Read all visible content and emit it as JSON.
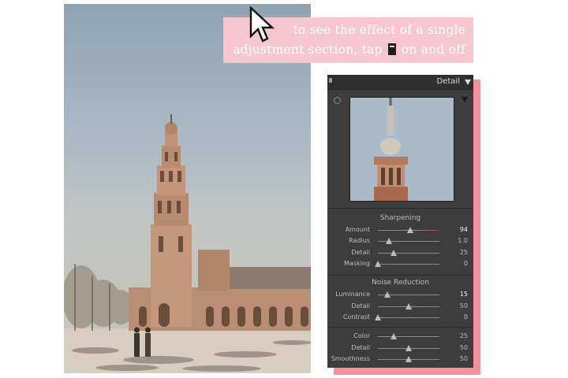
{
  "caption": {
    "line1": "to see the effect of a single",
    "line2_pre": "adjustment section, tap",
    "line2_post": "on and off",
    "tap_icon": "toggle-switch-icon"
  },
  "cursor_icon": "arrow-cursor-icon",
  "panel": {
    "title": "Detail",
    "sharpening": {
      "title": "Sharpening",
      "rows": [
        {
          "label": "Amount",
          "value": "94",
          "fraction": 0.53
        },
        {
          "label": "Radius",
          "value": "1.0",
          "fraction": 0.18
        },
        {
          "label": "Detail",
          "value": "25",
          "fraction": 0.25
        },
        {
          "label": "Masking",
          "value": "0",
          "fraction": 0.0
        }
      ]
    },
    "noise_reduction": {
      "title": "Noise Reduction",
      "luminance_rows": [
        {
          "label": "Luminance",
          "value": "15",
          "fraction": 0.15
        },
        {
          "label": "Detail",
          "value": "50",
          "fraction": 0.5
        },
        {
          "label": "Contrast",
          "value": "0",
          "fraction": 0.0
        }
      ],
      "color_rows": [
        {
          "label": "Color",
          "value": "25",
          "fraction": 0.25
        },
        {
          "label": "Detail",
          "value": "50",
          "fraction": 0.5
        },
        {
          "label": "Smoothness",
          "value": "50",
          "fraction": 0.5
        }
      ]
    }
  },
  "colors": {
    "caption_bg": "#f7c7d0",
    "panel_shadow": "#f4909f",
    "panel_bg": "#3d3d3d"
  }
}
